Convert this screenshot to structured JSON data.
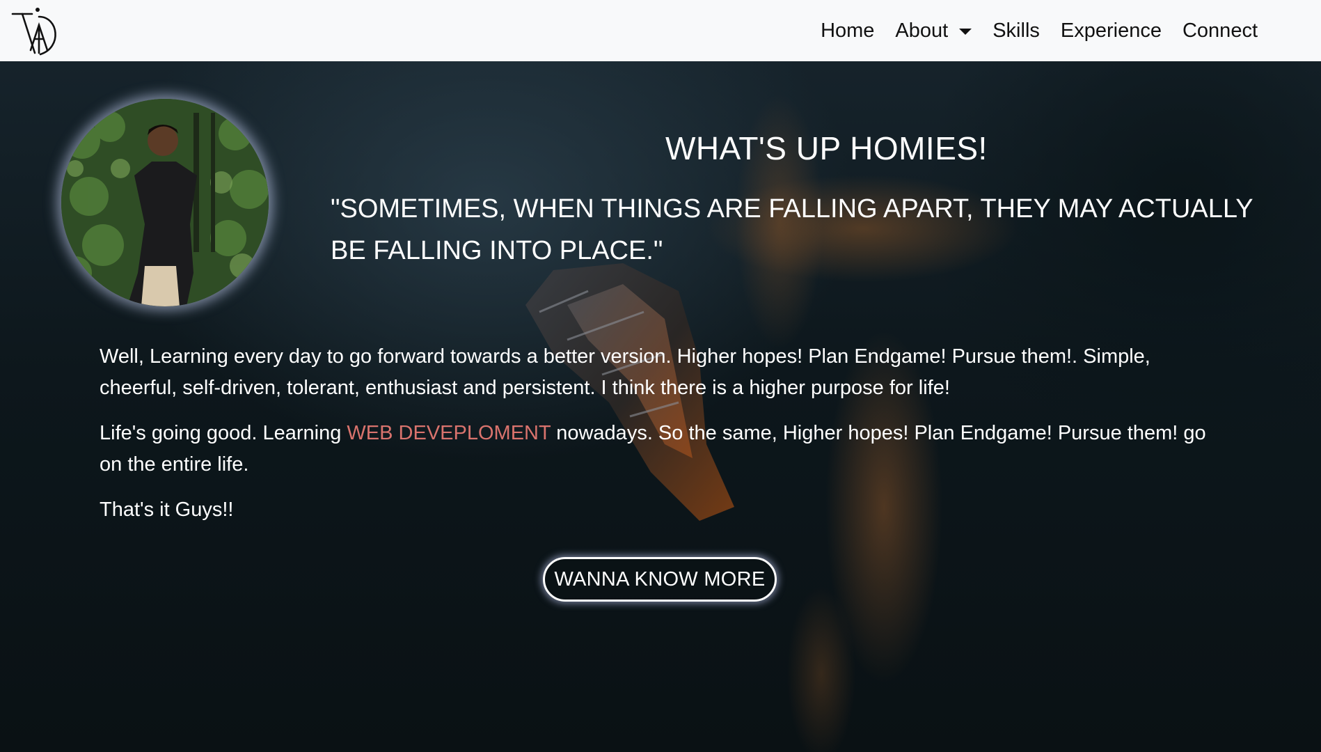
{
  "nav": {
    "logo_icon": "ad-monogram-logo",
    "items": [
      {
        "label": "Home"
      },
      {
        "label": "About",
        "has_dropdown": true
      },
      {
        "label": "Skills"
      },
      {
        "label": "Experience"
      },
      {
        "label": "Connect"
      }
    ]
  },
  "hero": {
    "title": "WHAT'S UP HOMIES!",
    "quote": "\"SOMETIMES, WHEN THINGS ARE FALLING APART, THEY MAY ACTUALLY BE FALLING INTO PLACE.\"",
    "paragraph1": "Well, Learning every day to go forward towards a better version. Higher hopes! Plan Endgame! Pursue them!. Simple, cheerful, self-driven, tolerant, enthusiast and persistent. I think there is a higher purpose for life!",
    "paragraph2_before": "Life's going good. Learning ",
    "paragraph2_highlight": "WEB DEVEPLOMENT",
    "paragraph2_after": " nowadays. So the same, Higher hopes! Plan Endgame! Pursue them! go on the entire life.",
    "paragraph3": "That's it Guys!!",
    "cta_label": "WANNA KNOW MORE"
  },
  "colors": {
    "navbar_bg": "#f8f9fa",
    "highlight": "#d9736d",
    "text": "#ffffff"
  }
}
